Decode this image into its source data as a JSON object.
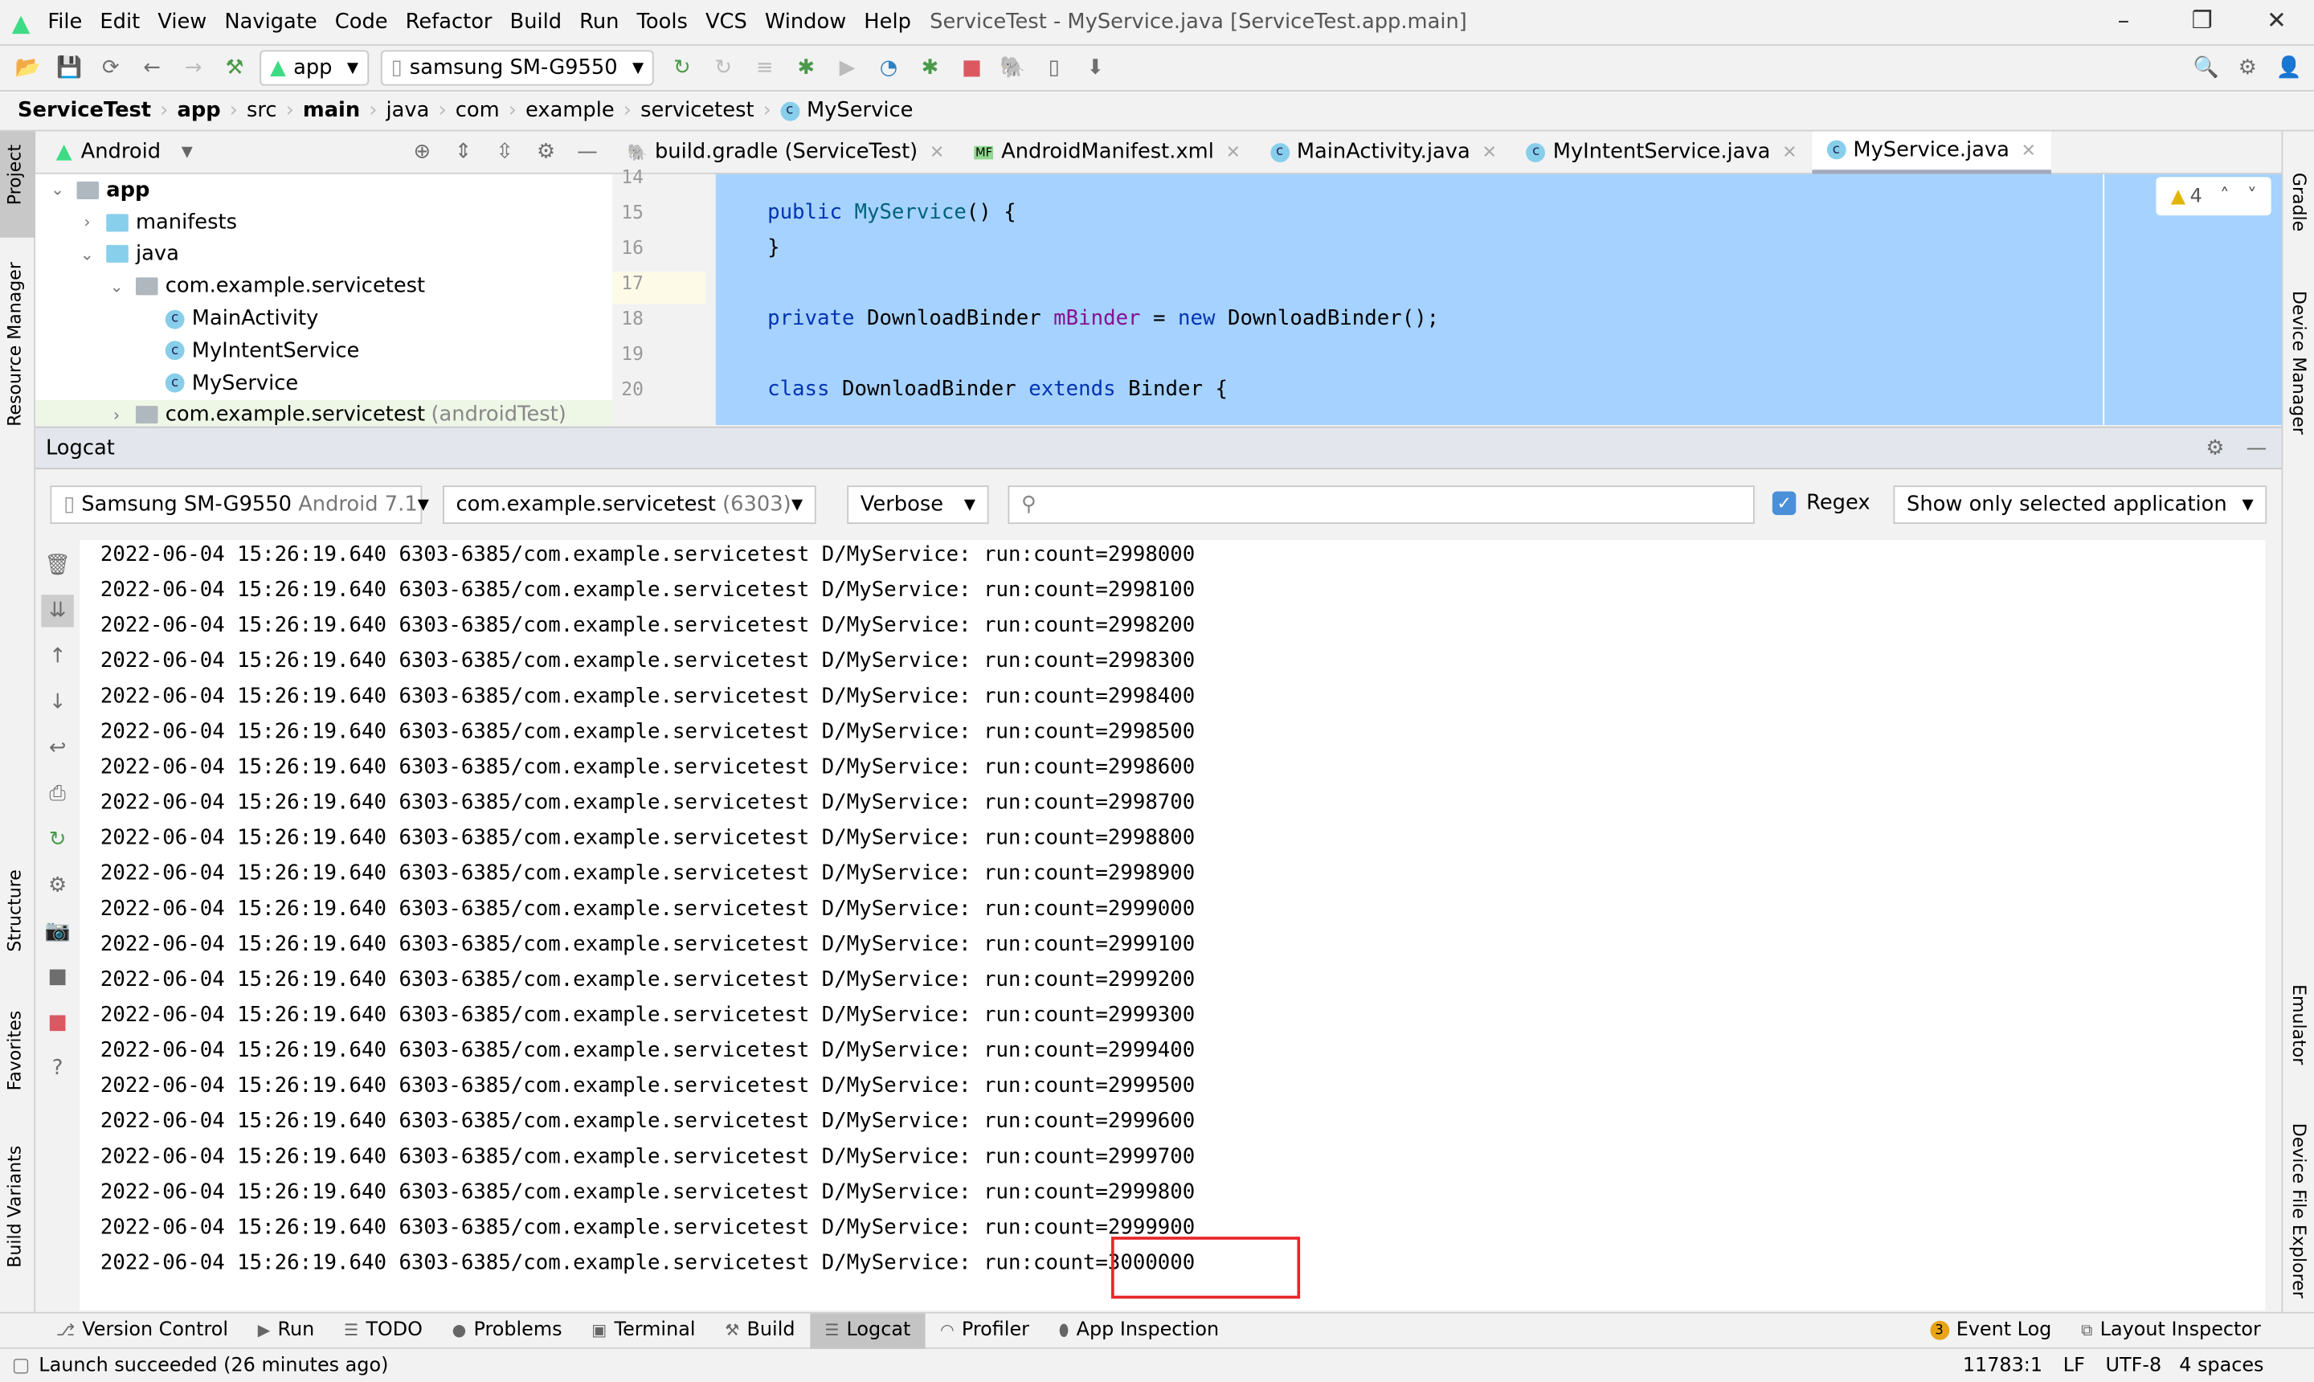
{
  "window": {
    "title": "ServiceTest - MyService.java [ServiceTest.app.main]",
    "minimize": "–",
    "restore": "❐",
    "close": "✕"
  },
  "menu": [
    "File",
    "Edit",
    "View",
    "Navigate",
    "Code",
    "Refactor",
    "Build",
    "Run",
    "Tools",
    "VCS",
    "Window",
    "Help"
  ],
  "toolbar": {
    "run_config": "app",
    "device": "samsung SM-G9550"
  },
  "breadcrumb": [
    "ServiceTest",
    "app",
    "src",
    "main",
    "java",
    "com",
    "example",
    "servicetest",
    "MyService"
  ],
  "left_stripe": [
    "Project",
    "Resource Manager",
    "Structure",
    "Favorites",
    "Build Variants"
  ],
  "right_stripe": [
    "Gradle",
    "Device Manager",
    "Emulator",
    "Device File Explorer"
  ],
  "project": {
    "view": "Android",
    "tree": [
      {
        "label": "app",
        "level": 0,
        "arrow": "⌄",
        "bold": true,
        "icon": "module"
      },
      {
        "label": "manifests",
        "level": 1,
        "arrow": "›",
        "icon": "folder"
      },
      {
        "label": "java",
        "level": 1,
        "arrow": "⌄",
        "icon": "folder"
      },
      {
        "label": "com.example.servicetest",
        "level": 2,
        "arrow": "⌄",
        "icon": "package"
      },
      {
        "label": "MainActivity",
        "level": 3,
        "icon": "class"
      },
      {
        "label": "MyIntentService",
        "level": 3,
        "icon": "class"
      },
      {
        "label": "MyService",
        "level": 3,
        "icon": "class"
      },
      {
        "label": "com.example.servicetest",
        "suffix": "(androidTest)",
        "level": 2,
        "arrow": "›",
        "icon": "package"
      }
    ]
  },
  "editor": {
    "tabs": [
      {
        "label": "build.gradle (ServiceTest)",
        "icon": "gradle"
      },
      {
        "label": "AndroidManifest.xml",
        "icon": "manifest"
      },
      {
        "label": "MainActivity.java",
        "icon": "class"
      },
      {
        "label": "MyIntentService.java",
        "icon": "class"
      },
      {
        "label": "MyService.java",
        "icon": "class",
        "active": true
      }
    ],
    "line_numbers": [
      "14",
      "15",
      "16",
      "17",
      "18",
      "19",
      "20"
    ],
    "warnings": "4",
    "code": {
      "l15a": "public",
      "l15b": "MyService",
      "l15c": "() {",
      "l16": "}",
      "l18a": "private",
      "l18b": " DownloadBinder ",
      "l18c": "mBinder",
      "l18d": " = ",
      "l18e": "new",
      "l18f": " DownloadBinder();",
      "l20a": "class",
      "l20b": " DownloadBinder ",
      "l20c": "extends",
      "l20d": " Binder {"
    }
  },
  "logcat": {
    "title": "Logcat",
    "device": "Samsung SM-G9550",
    "device_os": "Android 7.1",
    "process": "com.example.servicetest",
    "pid": "(6303)",
    "level": "Verbose",
    "search": "",
    "regex_label": "Regex",
    "regex_checked": true,
    "filter": "Show only selected application",
    "prefix": "2022-06-04 15:26:19.640 6303-6385/com.example.servicetest D/MyService: ",
    "lines": [
      "run:count=2998000",
      "run:count=2998100",
      "run:count=2998200",
      "run:count=2998300",
      "run:count=2998400",
      "run:count=2998500",
      "run:count=2998600",
      "run:count=2998700",
      "run:count=2998800",
      "run:count=2998900",
      "run:count=2999000",
      "run:count=2999100",
      "run:count=2999200",
      "run:count=2999300",
      "run:count=2999400",
      "run:count=2999500",
      "run:count=2999600",
      "run:count=2999700",
      "run:count=2999800",
      "run:count=2999900",
      "run:count=3000000"
    ],
    "highlight_color": "#e8262b"
  },
  "bottom_tabs": [
    {
      "label": "Version Control",
      "icon": "⎇"
    },
    {
      "label": "Run",
      "icon": "▶"
    },
    {
      "label": "TODO",
      "icon": "☰"
    },
    {
      "label": "Problems",
      "icon": "●"
    },
    {
      "label": "Terminal",
      "icon": "▣"
    },
    {
      "label": "Build",
      "icon": "⚒"
    },
    {
      "label": "Logcat",
      "icon": "☰",
      "active": true
    },
    {
      "label": "Profiler",
      "icon": "◠"
    },
    {
      "label": "App Inspection",
      "icon": "⬮"
    }
  ],
  "bottom_right": {
    "event_log": "Event Log",
    "event_count": "3",
    "layout_inspector": "Layout Inspector"
  },
  "status": {
    "message": "Launch succeeded (26 minutes ago)",
    "position": "11783:1",
    "line_sep": "LF",
    "encoding": "UTF-8",
    "indent": "4 spaces"
  }
}
